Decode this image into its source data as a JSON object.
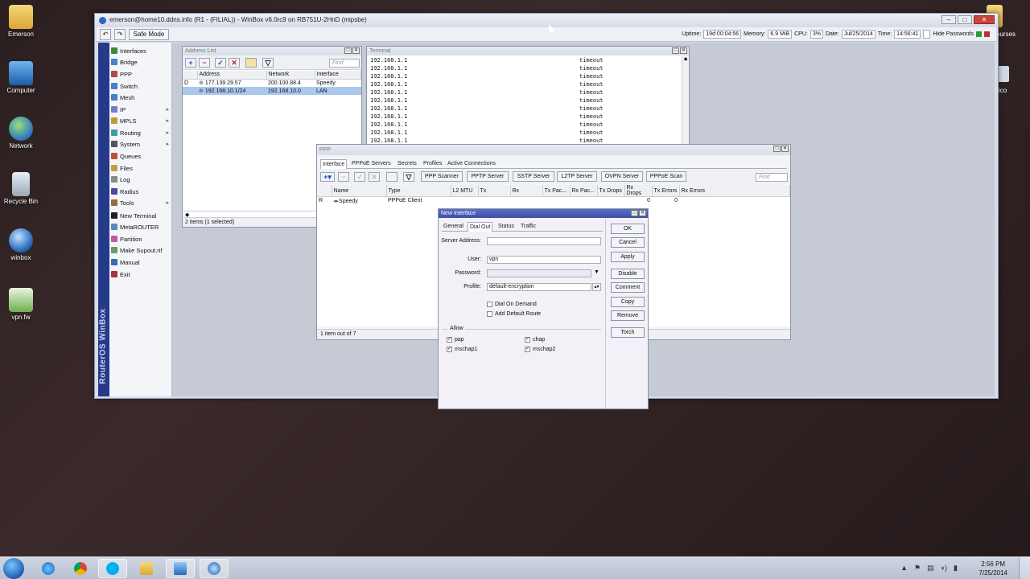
{
  "desktop": {
    "icons": [
      {
        "label": "Emerson"
      },
      {
        "label": "Computer"
      },
      {
        "label": "Network"
      },
      {
        "label": "Recycle Bin"
      },
      {
        "label": "winbox"
      },
      {
        "label": "vpn.fw"
      }
    ],
    "right_fragments": {
      "top": "ourses",
      "mid": "ico"
    }
  },
  "winbox": {
    "title": "emerson@home10.ddns.info (R1 - (FILIAL)) - WinBox v6.0rc9 on RB751U-2HnD (mipsbe)",
    "controls": {
      "minimize": "–",
      "maximize": "□",
      "close": "✕"
    },
    "toolbar": {
      "undo": "↶",
      "redo": "↷",
      "safe_mode": "Safe Mode",
      "uptime_label": "Uptime:",
      "uptime_value": "19d 00:04:56",
      "memory_label": "Memory:",
      "memory_value": "6.9 MiB",
      "cpu_label": "CPU:",
      "cpu_value": "3%",
      "date_label": "Date:",
      "date_value": "Jul/25/2014",
      "time_label": "Time:",
      "time_value": "14:56:41",
      "hide_passwords": "Hide Passwords"
    },
    "brand": "RouterOS WinBox",
    "menu": [
      {
        "label": "Interfaces",
        "sub": false,
        "color": "#3a8a3a"
      },
      {
        "label": "Bridge",
        "sub": false,
        "color": "#4a7fc9"
      },
      {
        "label": "PPP",
        "sub": false,
        "color": "#b24a4a"
      },
      {
        "label": "Switch",
        "sub": false,
        "color": "#4a7fc9"
      },
      {
        "label": "Mesh",
        "sub": false,
        "color": "#4a7fc9"
      },
      {
        "label": "IP",
        "sub": true,
        "color": "#7a7ac0"
      },
      {
        "label": "MPLS",
        "sub": true,
        "color": "#c09a3a"
      },
      {
        "label": "Routing",
        "sub": true,
        "color": "#3aa0a0"
      },
      {
        "label": "System",
        "sub": true,
        "color": "#555555"
      },
      {
        "label": "Queues",
        "sub": false,
        "color": "#c0503a"
      },
      {
        "label": "Files",
        "sub": false,
        "color": "#c0a040"
      },
      {
        "label": "Log",
        "sub": false,
        "color": "#888888"
      },
      {
        "label": "Radius",
        "sub": false,
        "color": "#4a4a9a"
      },
      {
        "label": "Tools",
        "sub": true,
        "color": "#9a6a3a"
      },
      {
        "label": "New Terminal",
        "sub": false,
        "color": "#222222"
      },
      {
        "label": "MetaROUTER",
        "sub": false,
        "color": "#5a8ac0"
      },
      {
        "label": "Partition",
        "sub": false,
        "color": "#c05a9a"
      },
      {
        "label": "Make Supout.rif",
        "sub": false,
        "color": "#6a9a6a"
      },
      {
        "label": "Manual",
        "sub": false,
        "color": "#3a6ab0"
      },
      {
        "label": "Exit",
        "sub": false,
        "color": "#aa3333"
      }
    ]
  },
  "address_list": {
    "title": "Address List",
    "find_placeholder": "Find",
    "columns": [
      "Address",
      "Network",
      "Interface"
    ],
    "rows": [
      {
        "flag": "D",
        "address": "177.139.29.57",
        "network": "200.100.88.4",
        "interface": "Speedy",
        "selected": false
      },
      {
        "flag": "",
        "address": "192.168.10.1/24",
        "network": "192.168.10.0",
        "interface": "LAN",
        "selected": true
      }
    ],
    "status": "2 items (1 selected)"
  },
  "terminal": {
    "title": "Terminal",
    "lines": [
      {
        "ip": "192.168.1.1",
        "result": "timeout"
      },
      {
        "ip": "192.168.1.1",
        "result": "timeout"
      },
      {
        "ip": "192.168.1.1",
        "result": "timeout"
      },
      {
        "ip": "192.168.1.1",
        "result": "timeout"
      },
      {
        "ip": "192.168.1.1",
        "result": "timeout"
      },
      {
        "ip": "192.168.1.1",
        "result": "timeout"
      },
      {
        "ip": "192.168.1.1",
        "result": "timeout"
      },
      {
        "ip": "192.168.1.1",
        "result": "timeout"
      },
      {
        "ip": "192.168.1.1",
        "result": "timeout"
      },
      {
        "ip": "192.168.1.1",
        "result": "timeout"
      },
      {
        "ip": "192.168.1.1",
        "result": "timeout"
      }
    ]
  },
  "ppp": {
    "title": "PPP",
    "tabs": [
      "Interface",
      "PPPoE Servers",
      "Secrets",
      "Profiles",
      "Active Connections"
    ],
    "services": [
      "PPP Scanner",
      "PPTP Server",
      "SSTP Server",
      "L2TP Server",
      "OVPN Server",
      "PPPoE Scan"
    ],
    "find_placeholder": "Find",
    "columns": [
      "Name",
      "Type",
      "L2 MTU",
      "Tx",
      "Rx",
      "Tx Pac...",
      "Rx Pac...",
      "Tx Drops",
      "Rx Drops",
      "Tx Errors",
      "Rx Errors"
    ],
    "row": {
      "flag": "R",
      "name": "Speedy",
      "type": "PPPoE Client",
      "rx_drops": "0",
      "tx_errors": "0"
    },
    "status": "1 item out of 7"
  },
  "new_interface": {
    "title": "New Interface",
    "tabs": [
      "General",
      "Dial Out",
      "Status",
      "Traffic"
    ],
    "fields": {
      "server_address_label": "Server Address:",
      "server_address_value": "",
      "user_label": "User:",
      "user_value": "vpn",
      "password_label": "Password:",
      "password_value": "",
      "profile_label": "Profile:",
      "profile_value": "default-encryption"
    },
    "options": {
      "dial_on_demand": "Dial On Demand",
      "add_default_route": "Add Default Route"
    },
    "allow_label": "Allow",
    "allow": [
      {
        "label": "pap",
        "checked": true
      },
      {
        "label": "chap",
        "checked": true
      },
      {
        "label": "mschap1",
        "checked": true
      },
      {
        "label": "mschap2",
        "checked": true
      }
    ],
    "buttons": [
      "OK",
      "Cancel",
      "Apply",
      "Disable",
      "Comment",
      "Copy",
      "Remove",
      "Torch"
    ]
  },
  "taskbar": {
    "time": "2:56 PM",
    "date": "7/25/2014"
  }
}
